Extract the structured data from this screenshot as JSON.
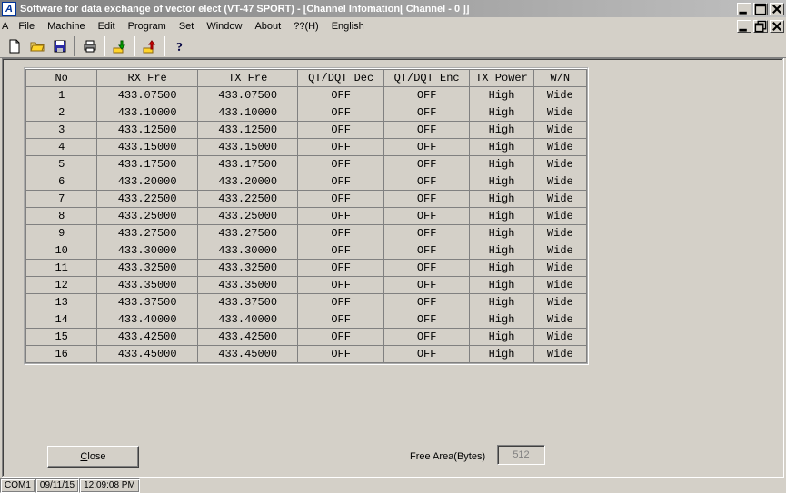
{
  "title": "Software for data exchange of vector elect (VT-47 SPORT) - [Channel Infomation[ Channel - 0 ]]",
  "menu": [
    "File",
    "Machine",
    "Edit",
    "Program",
    "Set",
    "Window",
    "About",
    "??(H)",
    "English"
  ],
  "close_button_prefix": "C",
  "close_button_rest": "lose",
  "free_label": "Free Area(Bytes)",
  "free_value": "512",
  "status": {
    "port": "COM1",
    "date": "09/11/15",
    "time": "12:09:08 PM"
  },
  "table": {
    "headers": [
      "No",
      "RX Fre",
      "TX Fre",
      "QT/DQT Dec",
      "QT/DQT Enc",
      "TX Power",
      "W/N"
    ],
    "rows": [
      {
        "no": "1",
        "rx": "433.07500",
        "tx": "433.07500",
        "dec": "OFF",
        "enc": "OFF",
        "pow": "High",
        "wn": "Wide"
      },
      {
        "no": "2",
        "rx": "433.10000",
        "tx": "433.10000",
        "dec": "OFF",
        "enc": "OFF",
        "pow": "High",
        "wn": "Wide"
      },
      {
        "no": "3",
        "rx": "433.12500",
        "tx": "433.12500",
        "dec": "OFF",
        "enc": "OFF",
        "pow": "High",
        "wn": "Wide"
      },
      {
        "no": "4",
        "rx": "433.15000",
        "tx": "433.15000",
        "dec": "OFF",
        "enc": "OFF",
        "pow": "High",
        "wn": "Wide"
      },
      {
        "no": "5",
        "rx": "433.17500",
        "tx": "433.17500",
        "dec": "OFF",
        "enc": "OFF",
        "pow": "High",
        "wn": "Wide"
      },
      {
        "no": "6",
        "rx": "433.20000",
        "tx": "433.20000",
        "dec": "OFF",
        "enc": "OFF",
        "pow": "High",
        "wn": "Wide"
      },
      {
        "no": "7",
        "rx": "433.22500",
        "tx": "433.22500",
        "dec": "OFF",
        "enc": "OFF",
        "pow": "High",
        "wn": "Wide"
      },
      {
        "no": "8",
        "rx": "433.25000",
        "tx": "433.25000",
        "dec": "OFF",
        "enc": "OFF",
        "pow": "High",
        "wn": "Wide"
      },
      {
        "no": "9",
        "rx": "433.27500",
        "tx": "433.27500",
        "dec": "OFF",
        "enc": "OFF",
        "pow": "High",
        "wn": "Wide"
      },
      {
        "no": "10",
        "rx": "433.30000",
        "tx": "433.30000",
        "dec": "OFF",
        "enc": "OFF",
        "pow": "High",
        "wn": "Wide"
      },
      {
        "no": "11",
        "rx": "433.32500",
        "tx": "433.32500",
        "dec": "OFF",
        "enc": "OFF",
        "pow": "High",
        "wn": "Wide"
      },
      {
        "no": "12",
        "rx": "433.35000",
        "tx": "433.35000",
        "dec": "OFF",
        "enc": "OFF",
        "pow": "High",
        "wn": "Wide"
      },
      {
        "no": "13",
        "rx": "433.37500",
        "tx": "433.37500",
        "dec": "OFF",
        "enc": "OFF",
        "pow": "High",
        "wn": "Wide"
      },
      {
        "no": "14",
        "rx": "433.40000",
        "tx": "433.40000",
        "dec": "OFF",
        "enc": "OFF",
        "pow": "High",
        "wn": "Wide"
      },
      {
        "no": "15",
        "rx": "433.42500",
        "tx": "433.42500",
        "dec": "OFF",
        "enc": "OFF",
        "pow": "High",
        "wn": "Wide"
      },
      {
        "no": "16",
        "rx": "433.45000",
        "tx": "433.45000",
        "dec": "OFF",
        "enc": "OFF",
        "pow": "High",
        "wn": "Wide"
      }
    ]
  }
}
